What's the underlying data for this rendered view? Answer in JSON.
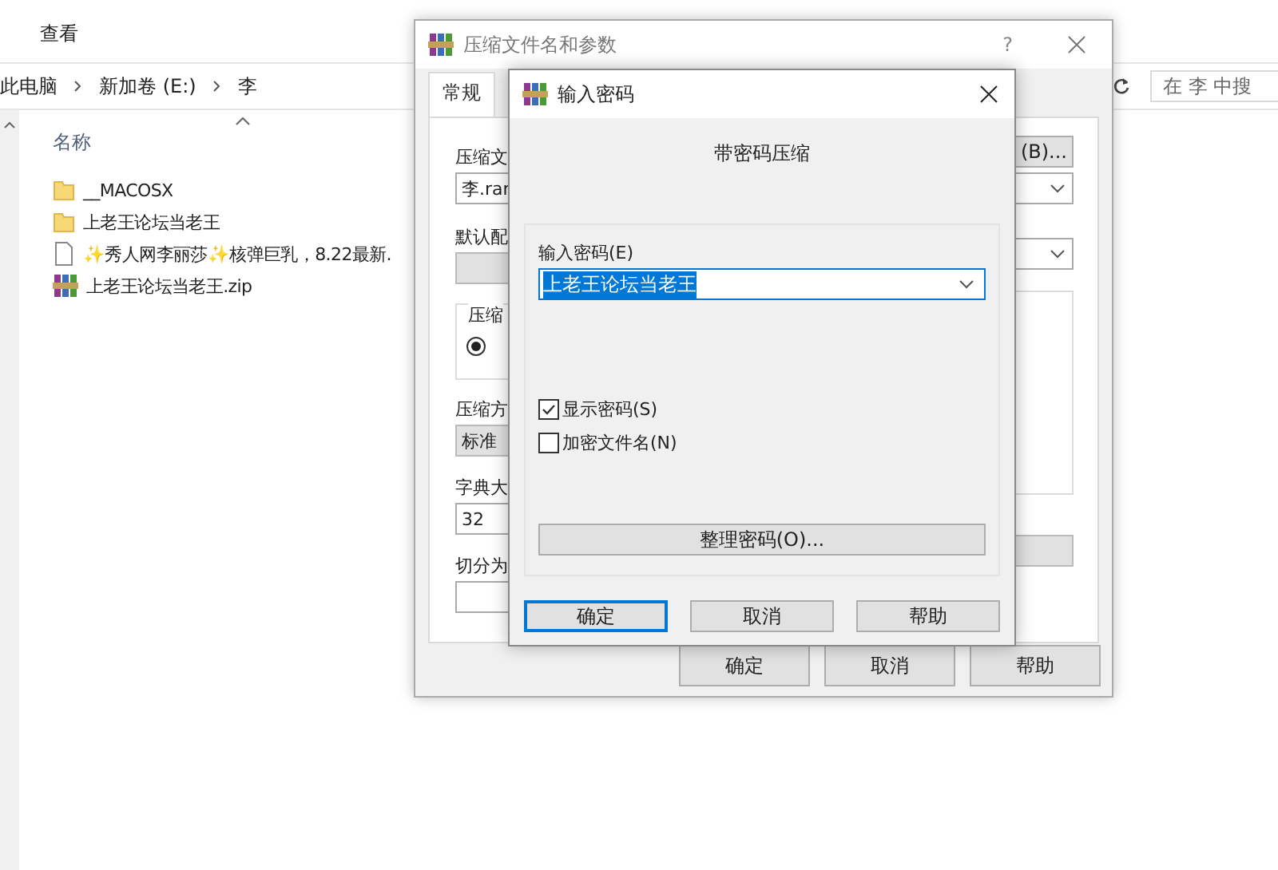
{
  "explorer": {
    "ribbon_tab": "查看",
    "breadcrumb": [
      "此电脑",
      "新加卷 (E:)",
      "李"
    ],
    "search": {
      "placeholder": "在 李 中搜"
    },
    "column": "名称",
    "files": [
      {
        "name": "__MACOSX",
        "kind": "folder"
      },
      {
        "name": "上老王论坛当老王",
        "kind": "folder"
      },
      {
        "name": "✨秀人网李丽莎✨核弹巨乳，8.22最新.",
        "kind": "file"
      },
      {
        "name": "上老王论坛当老王.zip",
        "kind": "archive"
      }
    ]
  },
  "archive_dialog": {
    "title": "压缩文件名和参数",
    "help": "?",
    "tabs": [
      {
        "label": "常规",
        "selected": true
      }
    ],
    "name_label": "压缩文",
    "name_value": "李.rar",
    "browse_button": "(B)...",
    "profile_label": "默认配",
    "format_group": "压缩",
    "format_option": {
      "selected": true
    },
    "method_label": "压缩方",
    "method_value": "标准",
    "dict_label": "字典大",
    "dict_value": "32",
    "split_label": "切分为",
    "buttons": [
      "确定",
      "取消",
      "帮助"
    ]
  },
  "password_dialog": {
    "title": "输入密码",
    "heading": "带密码压缩",
    "password_label": "输入密码(E)",
    "password_value": "上老王论坛当老王",
    "options": [
      {
        "label": "显示密码(S)",
        "checked": true
      },
      {
        "label": "加密文件名(N)",
        "checked": false
      }
    ],
    "manage_button": "整理密码(O)...",
    "buttons": [
      {
        "label": "确定",
        "default": true
      },
      {
        "label": "取消",
        "default": false
      },
      {
        "label": "帮助",
        "default": false
      }
    ]
  }
}
